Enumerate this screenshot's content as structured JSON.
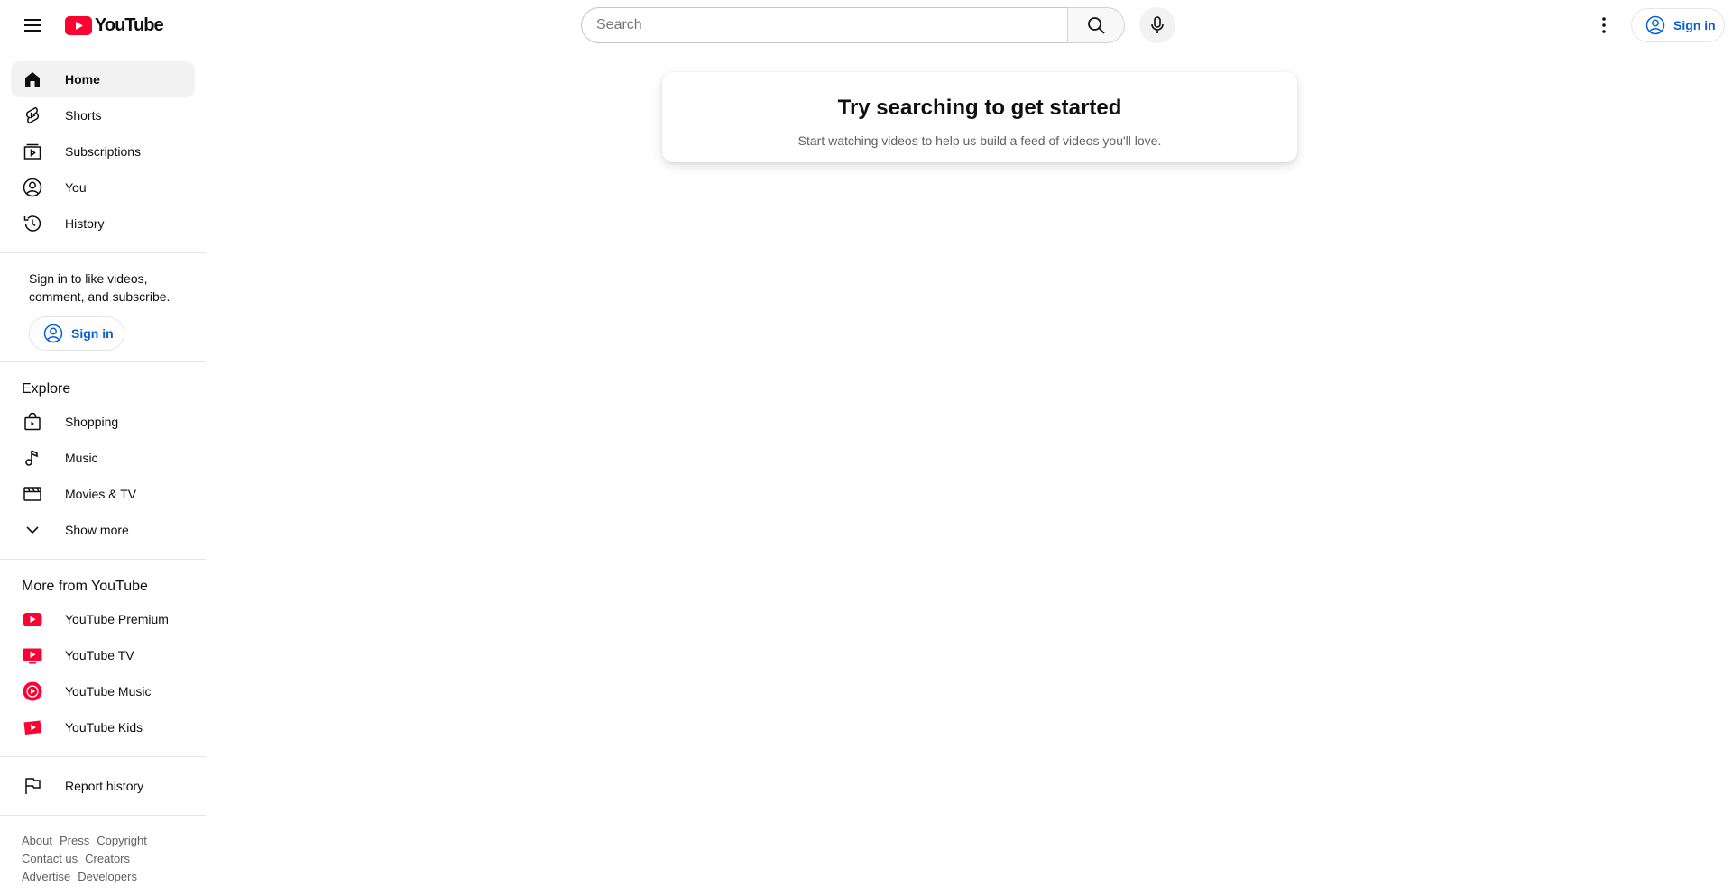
{
  "header": {
    "logo_text": "YouTube",
    "search": {
      "placeholder": "Search",
      "value": ""
    },
    "signin_label": "Sign in"
  },
  "sidebar": {
    "primary": [
      {
        "label": "Home",
        "icon": "home-icon",
        "active": true
      },
      {
        "label": "Shorts",
        "icon": "shorts-icon"
      },
      {
        "label": "Subscriptions",
        "icon": "subscriptions-icon"
      },
      {
        "label": "You",
        "icon": "you-icon"
      },
      {
        "label": "History",
        "icon": "history-icon"
      }
    ],
    "signin_blurb": "Sign in to like videos, comment, and subscribe.",
    "signin_label": "Sign in",
    "explore_title": "Explore",
    "explore": [
      {
        "label": "Shopping",
        "icon": "shopping-icon"
      },
      {
        "label": "Music",
        "icon": "music-icon"
      },
      {
        "label": "Movies & TV",
        "icon": "movies-icon"
      },
      {
        "label": "Show more",
        "icon": "chevron-down-icon"
      }
    ],
    "more_title": "More from YouTube",
    "more": [
      {
        "label": "YouTube Premium",
        "icon": "youtube-premium-icon"
      },
      {
        "label": "YouTube TV",
        "icon": "youtube-tv-icon"
      },
      {
        "label": "YouTube Music",
        "icon": "youtube-music-icon"
      },
      {
        "label": "YouTube Kids",
        "icon": "youtube-kids-icon"
      }
    ],
    "report_history": "Report history",
    "footer": {
      "row1": [
        "About",
        "Press",
        "Copyright"
      ],
      "row2": [
        "Contact us",
        "Creators"
      ],
      "row3": [
        "Advertise",
        "Developers"
      ]
    }
  },
  "main": {
    "empty_title": "Try searching to get started",
    "empty_subtitle": "Start watching videos to help us build a feed of videos you'll love."
  },
  "colors": {
    "brand_red": "#ff0033",
    "link_blue": "#065fd4",
    "active_bg": "#f2f2f2"
  }
}
